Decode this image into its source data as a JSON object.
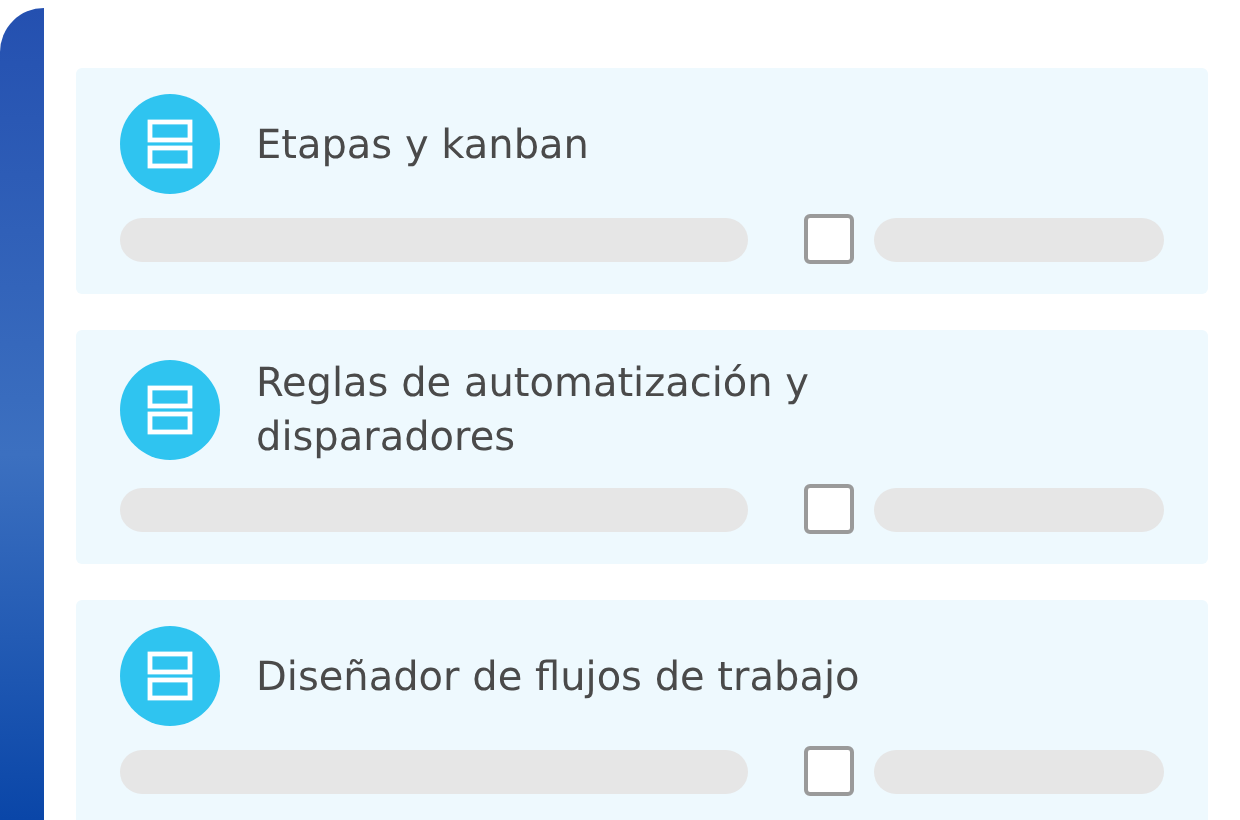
{
  "items": [
    {
      "title": "Etapas y kanban",
      "checked": false
    },
    {
      "title": "Reglas de automatización y disparadores",
      "checked": false
    },
    {
      "title": "Diseñador de flujos de trabajo",
      "checked": false
    }
  ]
}
